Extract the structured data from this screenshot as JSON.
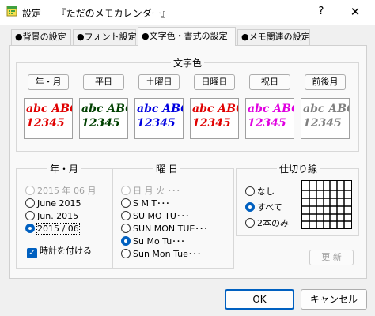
{
  "window": {
    "title": "設定 － 『ただのメモカレンダー』",
    "help": "?",
    "close": "✕"
  },
  "tabs": [
    {
      "label": "●背景の設定"
    },
    {
      "label": "●フォント設定"
    },
    {
      "label": "●文字色・書式の設定"
    },
    {
      "label": "●メモ関連の設定"
    }
  ],
  "text_color": {
    "title": "文字色",
    "buttons": [
      "年・月",
      "平日",
      "土曜日",
      "日曜日",
      "祝日",
      "前後月"
    ],
    "samples": [
      {
        "line1": "abc ABC",
        "line2": "12345",
        "color": "#e00000"
      },
      {
        "line1": "abc ABC",
        "line2": "12345",
        "color": "#004000"
      },
      {
        "line1": "abc ABC",
        "line2": "12345",
        "color": "#0000e0"
      },
      {
        "line1": "abc ABC",
        "line2": "12345",
        "color": "#e00000"
      },
      {
        "line1": "abc ABC",
        "line2": "12345",
        "color": "#e000e0"
      },
      {
        "line1": "abc ABC",
        "line2": "12345",
        "color": "#808080"
      }
    ]
  },
  "year_month": {
    "title": "年・月",
    "options": [
      "2015 年 06 月",
      "June 2015",
      "Jun. 2015",
      "2015 / 06"
    ],
    "selected": "2015 / 06",
    "clock_label": "時計を付ける",
    "clock_checked": true
  },
  "weekday": {
    "title": "曜 日",
    "options": [
      "日 月 火 ･･･",
      "S  M  T･･･",
      "SU  MO  TU･･･",
      "SUN  MON  TUE･･･",
      "Su  Mo  Tu･･･",
      "Sun  Mon  Tue･･･"
    ],
    "selected": "Su  Mo  Tu･･･"
  },
  "divider": {
    "title": "仕切り線",
    "options": [
      "なし",
      "すべて",
      "2本のみ"
    ],
    "selected": "すべて"
  },
  "update_button": "更 新",
  "ok_button": "OK",
  "cancel_button": "キャンセル"
}
